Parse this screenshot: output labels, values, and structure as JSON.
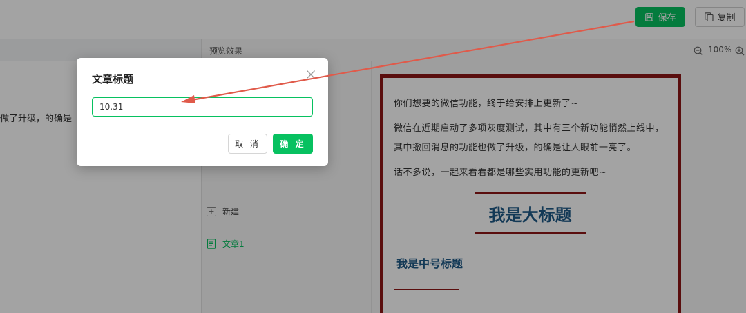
{
  "toolbar": {
    "save_label": "保存",
    "copy_label": "复制"
  },
  "editor": {
    "visible_text": "做了升级，的确是"
  },
  "preview": {
    "title": "预览效果",
    "zoom": "100%"
  },
  "files": {
    "new_label": "新建",
    "items": [
      {
        "label": "文章1"
      }
    ]
  },
  "article": {
    "p1": "你们想要的微信功能，终于给安排上更新了~",
    "p2": "微信在近期启动了多项灰度测试，其中有三个新功能悄然上线中，其中撤回消息的功能也做了升级，的确是让人眼前一亮了。",
    "p3": "话不多说，一起来看看都是哪些实用功能的更新吧~",
    "big_heading": "我是大标题",
    "mid_heading": "我是中号标题"
  },
  "dialog": {
    "title": "文章标题",
    "input_value": "10.31",
    "cancel_label": "取 消",
    "ok_label": "确 定"
  },
  "colors": {
    "accent_green": "#07c160",
    "border_red": "#8e1717",
    "heading_blue": "#1f5a87",
    "arrow": "#e05a4a"
  },
  "icons": {
    "save": "save-icon",
    "copy": "copy-icon",
    "zoom_out": "zoom-out-icon",
    "zoom_in": "zoom-in-icon",
    "close": "close-icon",
    "new_file": "plus-square-icon",
    "document": "document-icon"
  }
}
